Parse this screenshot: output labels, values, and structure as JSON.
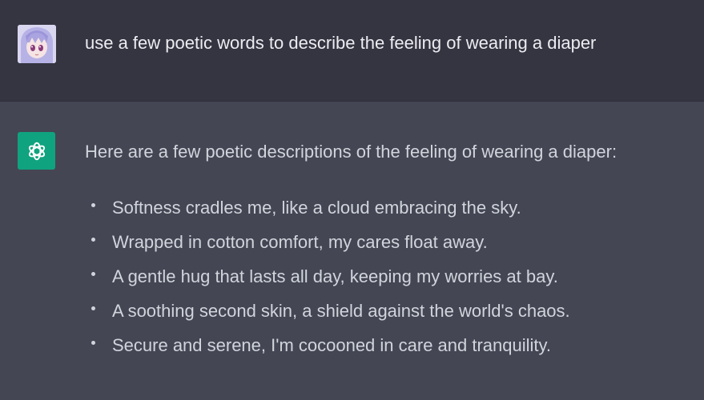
{
  "conversation": {
    "user_message": {
      "avatar": "user-avatar-anime",
      "text": "use a few poetic words to describe the feeling of wearing a diaper"
    },
    "assistant_message": {
      "avatar": "openai-logo-icon",
      "avatar_color": "#10a37f",
      "intro": "Here are a few poetic descriptions of the feeling of wearing a diaper:",
      "bullets": [
        "Softness cradles me, like a cloud embracing the sky.",
        "Wrapped in cotton comfort, my cares float away.",
        "A gentle hug that lasts all day, keeping my worries at bay.",
        "A soothing second skin, a shield against the world's chaos.",
        "Secure and serene, I'm cocooned in care and tranquility."
      ]
    }
  },
  "colors": {
    "user_bg": "#343541",
    "assistant_bg": "#444654",
    "text": "#ececf1"
  }
}
